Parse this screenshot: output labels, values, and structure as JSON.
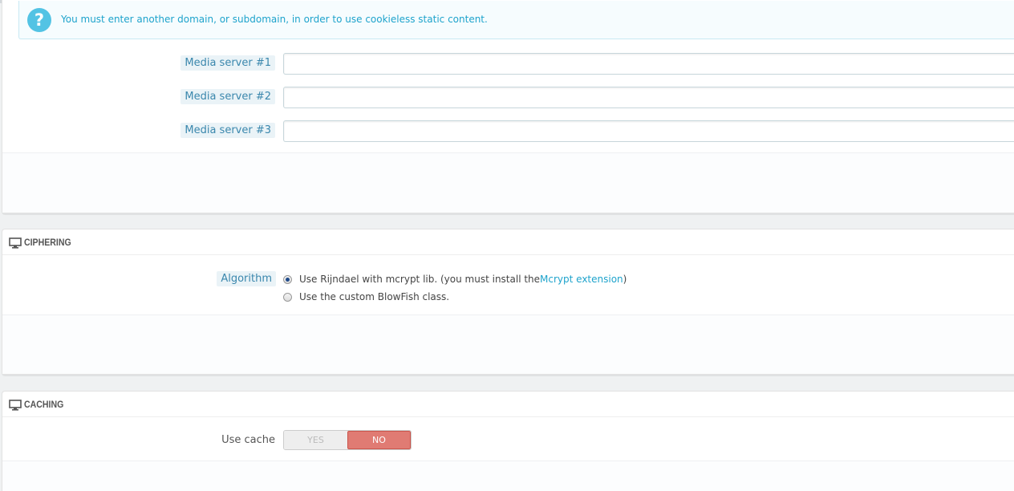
{
  "alert": {
    "icon": "question-circle-icon",
    "text": "You must enter another domain, or subdomain, in order to use cookieless static content."
  },
  "media_servers": [
    {
      "label": "Media server #1",
      "value": ""
    },
    {
      "label": "Media server #2",
      "value": ""
    },
    {
      "label": "Media server #3",
      "value": ""
    }
  ],
  "ciphering": {
    "title": "CIPHERING",
    "algorithm_label": "Algorithm",
    "option1_prefix": "Use Rijndael with mcrypt lib. (you must install the ",
    "option1_link": "Mcrypt extension",
    "option1_suffix": ")",
    "option2": "Use the custom BlowFish class.",
    "selected": "option1"
  },
  "caching": {
    "title": "CACHING",
    "use_cache_label": "Use cache",
    "yes": "YES",
    "no": "NO",
    "value": "NO"
  },
  "colors": {
    "accent": "#1ea3cc",
    "no_active": "#e07b73"
  }
}
